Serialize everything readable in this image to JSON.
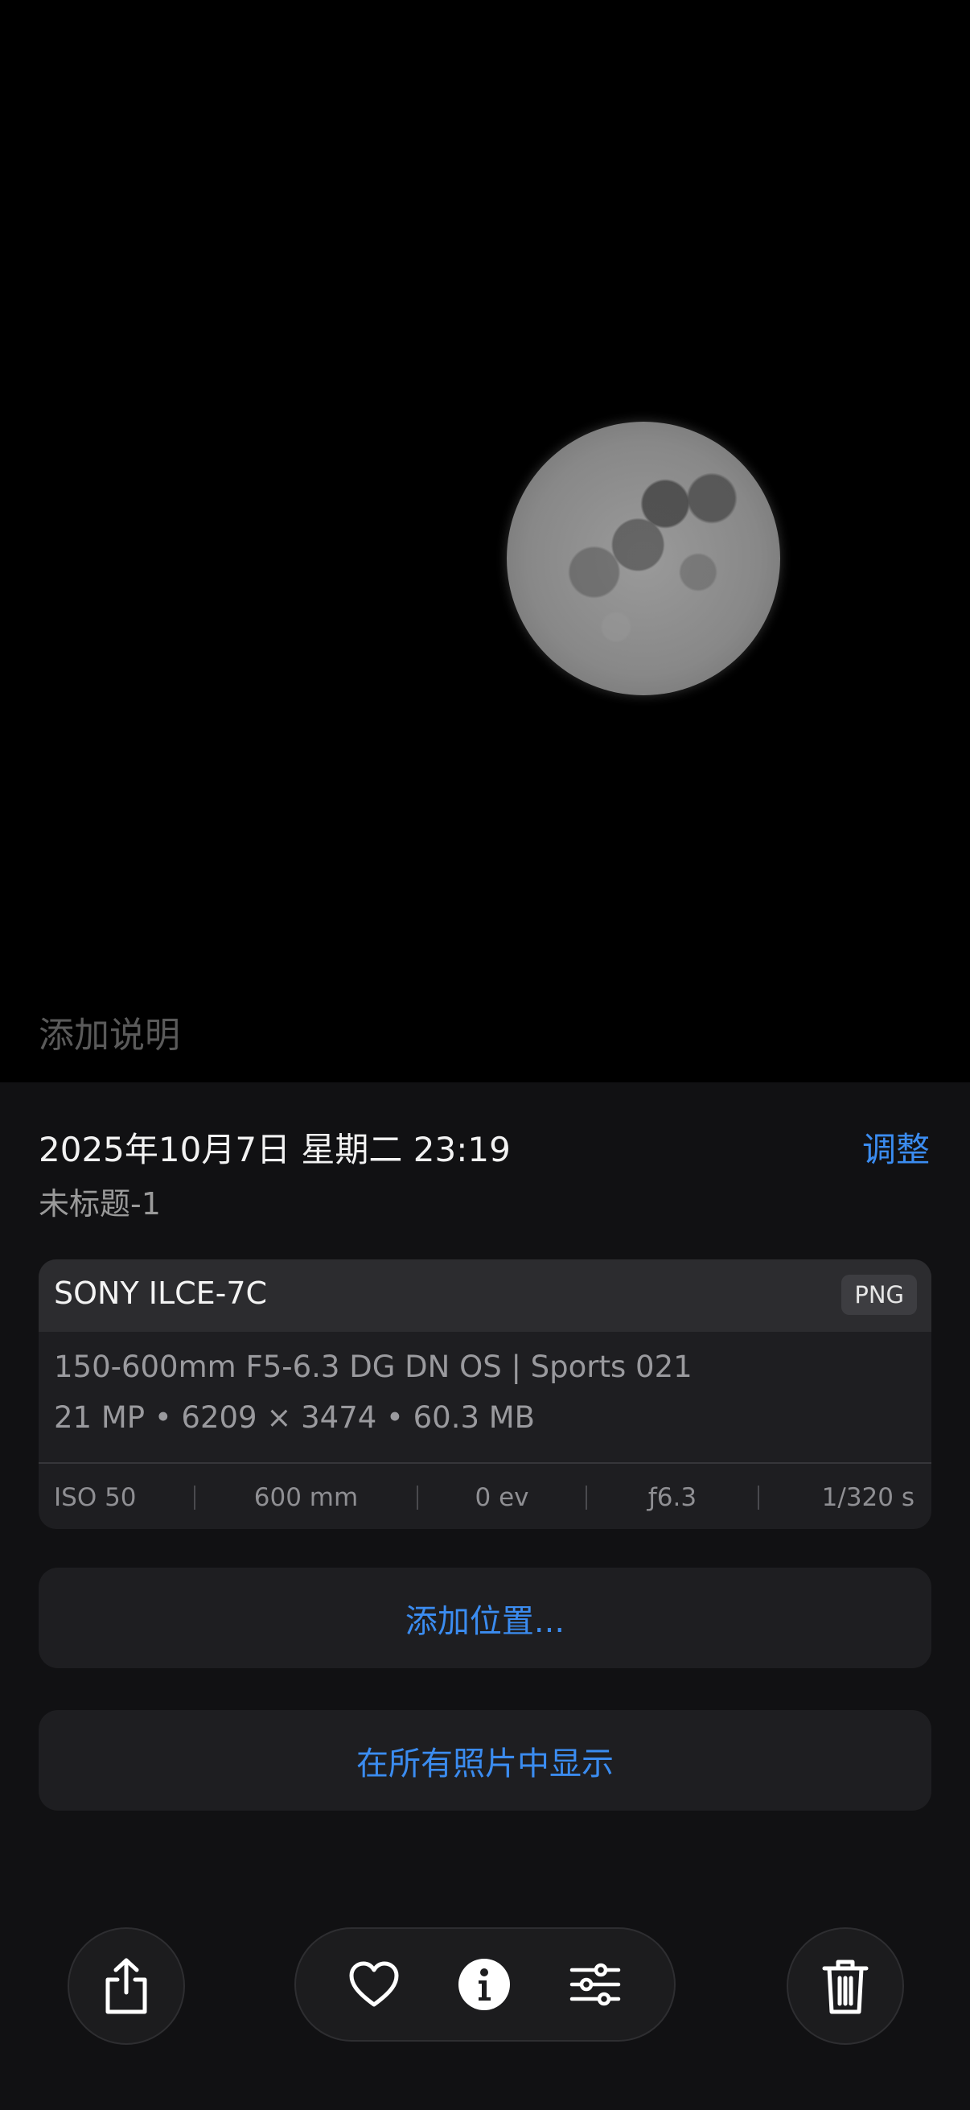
{
  "photo": {
    "caption_placeholder": "添加说明"
  },
  "info": {
    "datetime": "2025年10月7日 星期二 23:19",
    "adjust_label": "调整",
    "filename": "未标题-1"
  },
  "camera": {
    "model": "SONY ILCE-7C",
    "format": "PNG",
    "lens": "150-600mm F5-6.3 DG DN OS | Sports 021",
    "specs": "21 MP • 6209 × 3474 • 60.3 MB",
    "exif": {
      "iso": "ISO 50",
      "focal_length": "600 mm",
      "exposure_bias": "0 ev",
      "aperture": "ƒ6.3",
      "shutter": "1/320 s"
    }
  },
  "actions": {
    "add_location": "添加位置...",
    "show_in_all_photos": "在所有照片中显示"
  },
  "toolbar": {
    "share_icon": "share-icon",
    "favorite_icon": "heart-icon",
    "info_icon": "info-icon",
    "adjust_icon": "sliders-icon",
    "delete_icon": "trash-icon"
  },
  "colors": {
    "accent": "#3b8cf0",
    "panel_bg": "#111113",
    "card_bg": "#1e1e21"
  }
}
